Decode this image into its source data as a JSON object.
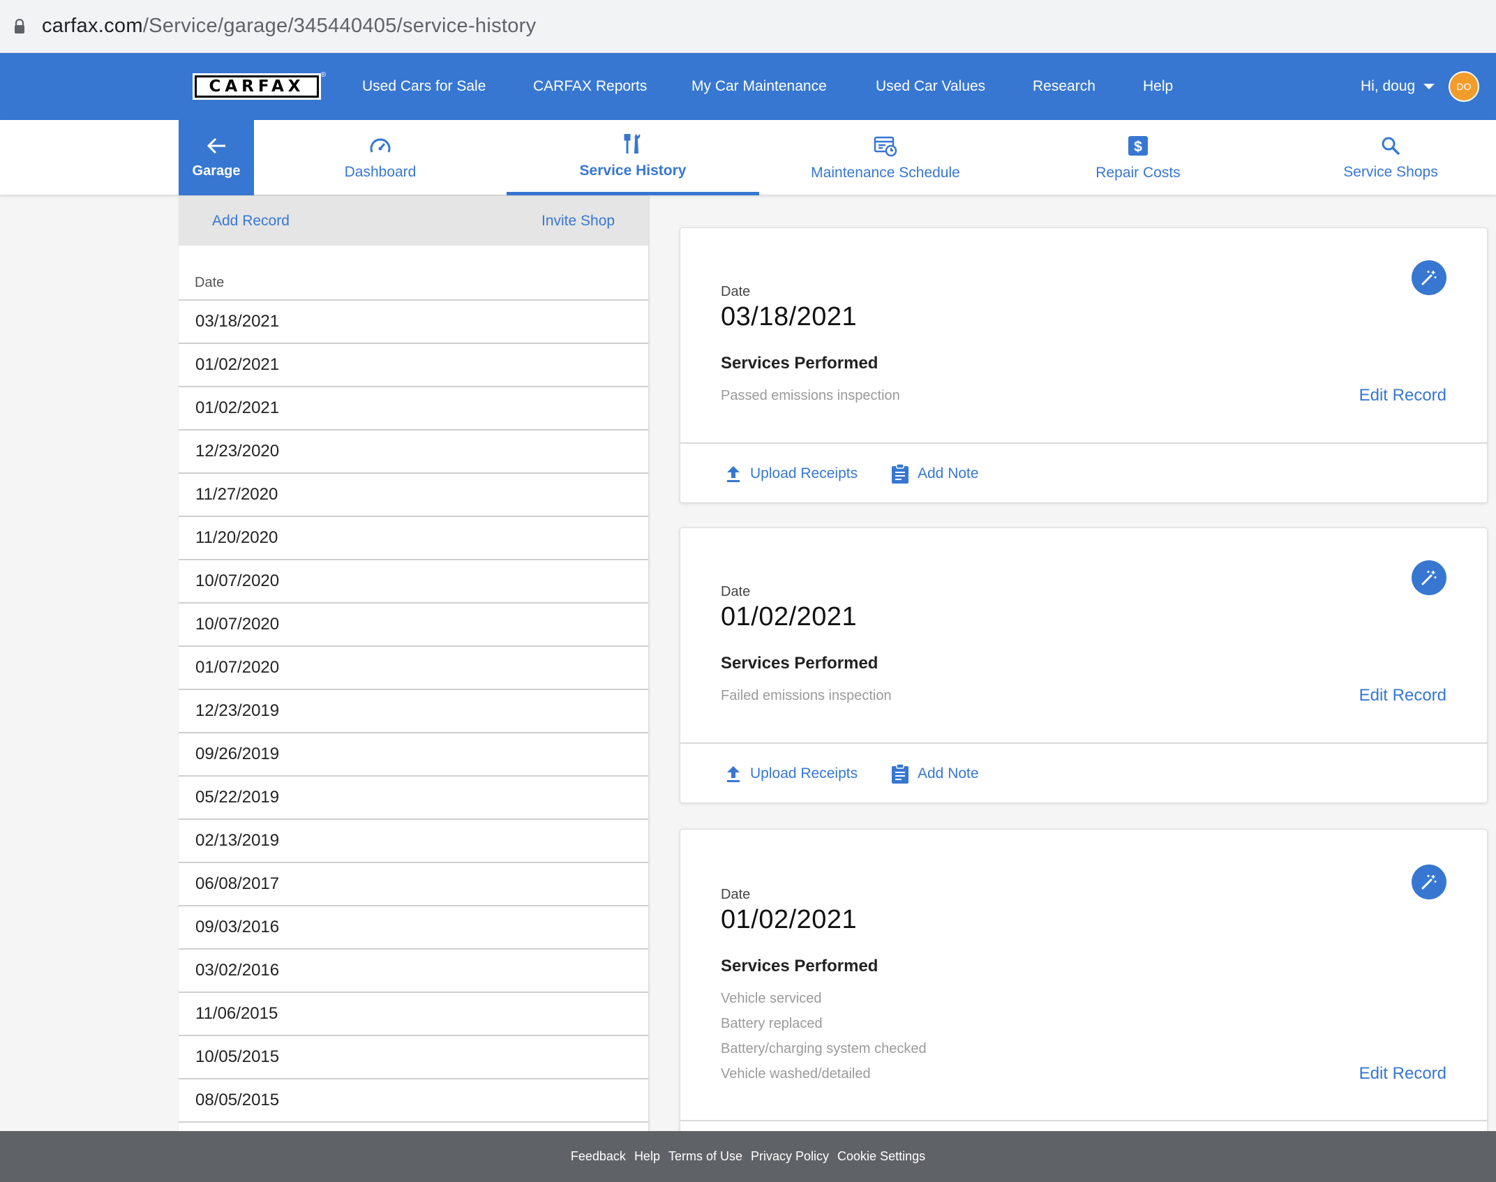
{
  "browser": {
    "url_host": "carfax.com",
    "url_path": "/Service/garage/345440405/service-history"
  },
  "topnav": {
    "logo": "CARFAX",
    "links": [
      "Used Cars for Sale",
      "CARFAX Reports",
      "My Car Maintenance",
      "Used Car Values",
      "Research",
      "Help"
    ],
    "greeting": "Hi, doug",
    "avatar_initials": "DO",
    "colors": {
      "primary": "#3777d1",
      "avatar": "#f29d2b"
    }
  },
  "subnav": {
    "garage_label": "Garage",
    "tabs": [
      {
        "label": "Dashboard",
        "icon": "speedometer-icon"
      },
      {
        "label": "Service History",
        "icon": "tools-icon",
        "active": true
      },
      {
        "label": "Maintenance Schedule",
        "icon": "calendar-clock-icon"
      },
      {
        "label": "Repair Costs",
        "icon": "dollar-icon"
      },
      {
        "label": "Service Shops",
        "icon": "search-icon"
      }
    ]
  },
  "leftpanel": {
    "add_record": "Add Record",
    "invite_shop": "Invite Shop",
    "date_header": "Date",
    "dates": [
      "03/18/2021",
      "01/02/2021",
      "01/02/2021",
      "12/23/2020",
      "11/27/2020",
      "11/20/2020",
      "10/07/2020",
      "10/07/2020",
      "01/07/2020",
      "12/23/2019",
      "09/26/2019",
      "05/22/2019",
      "02/13/2019",
      "06/08/2017",
      "09/03/2016",
      "03/02/2016",
      "11/06/2015",
      "10/05/2015",
      "08/05/2015"
    ]
  },
  "records": [
    {
      "date_label": "Date",
      "date": "03/18/2021",
      "services_label": "Services Performed",
      "services": [
        "Passed emissions inspection"
      ],
      "edit_label": "Edit Record",
      "upload_label": "Upload Receipts",
      "note_label": "Add Note"
    },
    {
      "date_label": "Date",
      "date": "01/02/2021",
      "services_label": "Services Performed",
      "services": [
        "Failed emissions inspection"
      ],
      "edit_label": "Edit Record",
      "upload_label": "Upload Receipts",
      "note_label": "Add Note"
    },
    {
      "date_label": "Date",
      "date": "01/02/2021",
      "services_label": "Services Performed",
      "services": [
        "Vehicle serviced",
        "Battery replaced",
        "Battery/charging system checked",
        "Vehicle washed/detailed"
      ],
      "edit_label": "Edit Record"
    }
  ],
  "footer": {
    "links": [
      "Feedback",
      "Help",
      "Terms of Use",
      "Privacy Policy",
      "Cookie Settings"
    ]
  }
}
